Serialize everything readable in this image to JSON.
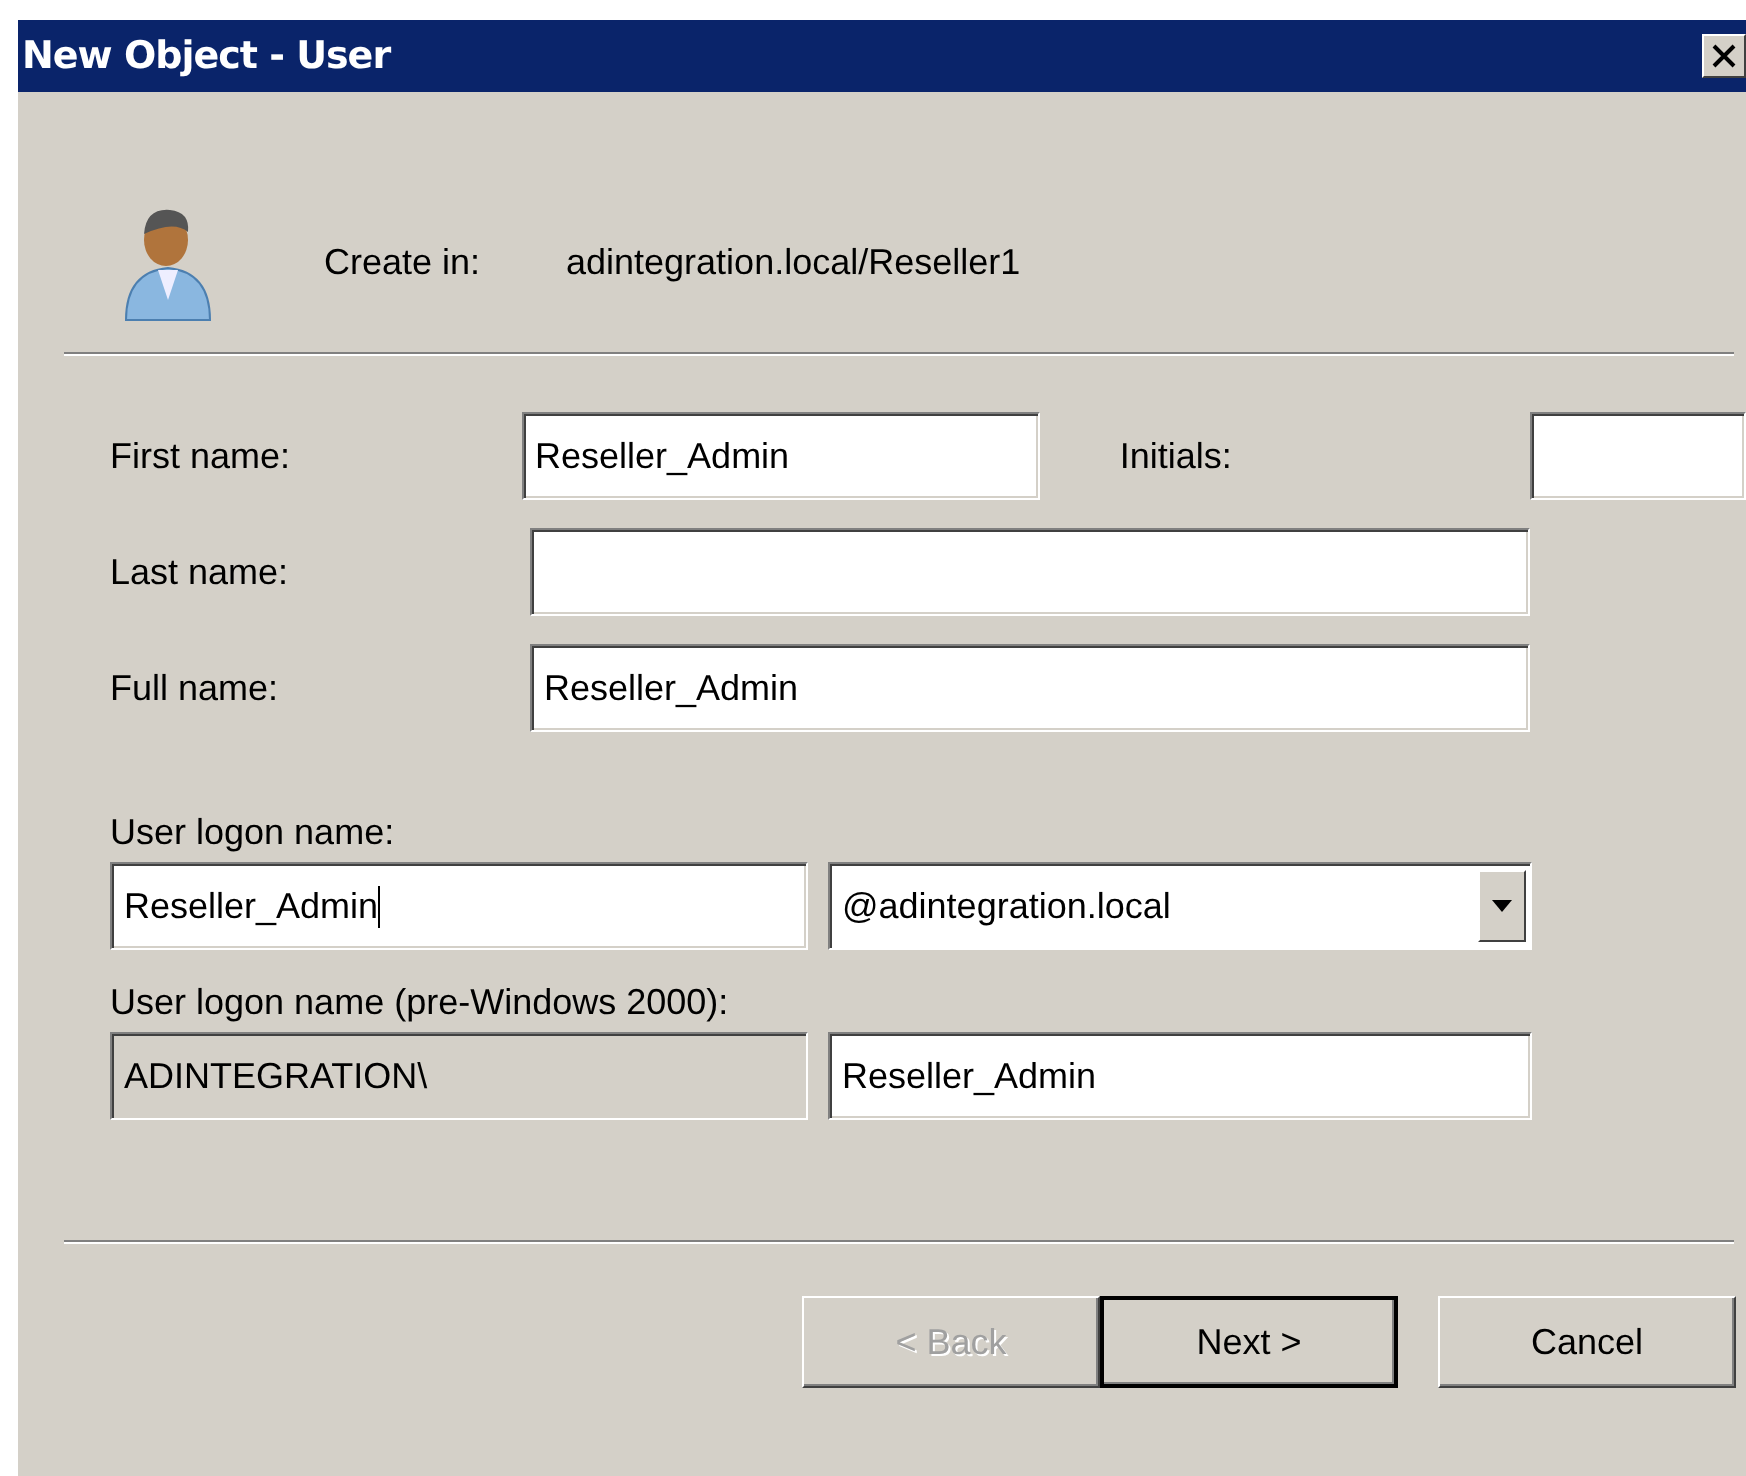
{
  "window": {
    "title": "New Object - User"
  },
  "create_in": {
    "label": "Create in:",
    "value": "adintegration.local/Reseller1"
  },
  "name_fields": [
    {
      "label": "First name:",
      "value": "Reseller_Admin"
    },
    {
      "label": "Initials:"
    },
    {
      "label": "Last name:"
    },
    {
      "label": "Full name:",
      "value": "Reseller_Admin"
    }
  ],
  "logon": {
    "label": "User logon name:",
    "value": "Reseller_Admin",
    "focused": true,
    "domain": "@adintegration.local"
  },
  "pre_windows": {
    "label": "User logon name (pre-Windows 2000):",
    "domain": "ADINTEGRATION\\",
    "domain_disabled": true,
    "value": "Reseller_Admin"
  },
  "buttons": [
    {
      "label": "< Back",
      "disabled": true,
      "default": false
    },
    {
      "label": "Next >",
      "disabled": false,
      "default": true
    },
    {
      "label": "Cancel",
      "disabled": false,
      "default": false
    }
  ]
}
